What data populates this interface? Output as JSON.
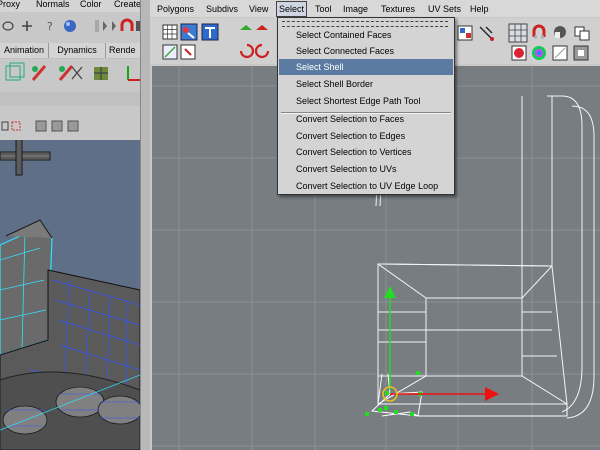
{
  "left_window": {
    "menu": [
      "Proxy",
      "Normals",
      "Color",
      "Create"
    ],
    "tabs": [
      "Animation",
      "Dynamics",
      "Rende"
    ]
  },
  "menubar": [
    "Polygons",
    "Subdivs",
    "View",
    "Select",
    "Tool",
    "Image",
    "Textures",
    "UV Sets",
    "Help"
  ],
  "select_menu": {
    "group1": [
      "Select Contained Faces",
      "Select Connected Faces",
      "Select Shell",
      "Select Shell Border",
      "Select Shortest Edge Path Tool"
    ],
    "group2": [
      "Convert Selection to Faces",
      "Convert Selection to Edges",
      "Convert Selection to Vertices",
      "Convert Selection to UVs",
      "Convert Selection to UV Edge Loop"
    ],
    "highlighted": "Select Shell"
  },
  "colors": {
    "highlight": "#5c7ba3",
    "uv_background": "#777d81",
    "move_y_axis": "#22dd22",
    "move_x_axis": "#ee1111",
    "viewport_background": "#5e6f87",
    "wire_cyan": "#33e0ff"
  },
  "icons": [
    "checker-icon",
    "uv-snapshot-icon",
    "move-uv-icon",
    "rotate-ccw-icon",
    "rotate-cw-icon",
    "flip-icon",
    "grid-icon",
    "magnet-icon",
    "dim-image-icon",
    "select-icon",
    "lasso-icon",
    "paint-select-icon",
    "question-icon",
    "sphere-icon",
    "cube-icon"
  ]
}
